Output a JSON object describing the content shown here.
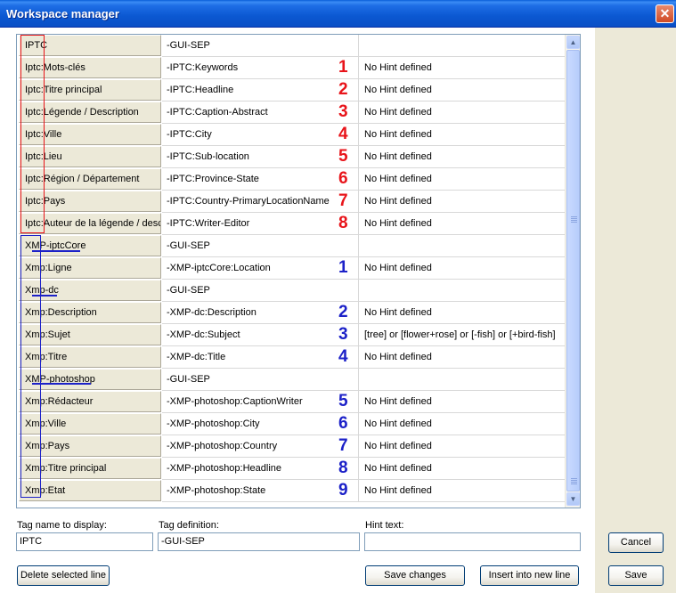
{
  "window": {
    "title": "Workspace manager",
    "close_glyph": "✕"
  },
  "grid": {
    "rows": [
      {
        "tag": "IPTC",
        "definition": "-GUI-SEP",
        "hint": "",
        "marker": ""
      },
      {
        "tag": "Iptc:Mots-clés",
        "definition": "-IPTC:Keywords",
        "hint": "No Hint defined",
        "marker": "1"
      },
      {
        "tag": "Iptc:Titre principal",
        "definition": "-IPTC:Headline",
        "hint": "No Hint defined",
        "marker": "2"
      },
      {
        "tag": "Iptc:Légende / Description",
        "definition": "-IPTC:Caption-Abstract",
        "hint": "No Hint defined",
        "marker": "3"
      },
      {
        "tag": "Iptc:Ville",
        "definition": "-IPTC:City",
        "hint": "No Hint defined",
        "marker": "4"
      },
      {
        "tag": "Iptc:Lieu",
        "definition": "-IPTC:Sub-location",
        "hint": "No Hint defined",
        "marker": "5"
      },
      {
        "tag": "Iptc:Région / Département",
        "definition": "-IPTC:Province-State",
        "hint": "No Hint defined",
        "marker": "6"
      },
      {
        "tag": "Iptc:Pays",
        "definition": "-IPTC:Country-PrimaryLocationName",
        "hint": "No Hint defined",
        "marker": "7"
      },
      {
        "tag": "Iptc:Auteur de la légende / descr",
        "definition": "-IPTC:Writer-Editor",
        "hint": "No Hint defined",
        "marker": "8"
      },
      {
        "tag": "XMP-iptcCore",
        "definition": "-GUI-SEP",
        "hint": "",
        "marker": ""
      },
      {
        "tag": "Xmp:Ligne",
        "definition": "-XMP-iptcCore:Location",
        "hint": "No Hint defined",
        "marker": "1"
      },
      {
        "tag": "Xmp-dc",
        "definition": "-GUI-SEP",
        "hint": "",
        "marker": ""
      },
      {
        "tag": "Xmp:Description",
        "definition": "-XMP-dc:Description",
        "hint": "No Hint defined",
        "marker": "2"
      },
      {
        "tag": "Xmp:Sujet",
        "definition": "-XMP-dc:Subject",
        "hint": "[tree] or [flower+rose] or [-fish] or [+bird-fish]",
        "marker": "3"
      },
      {
        "tag": "Xmp:Titre",
        "definition": "-XMP-dc:Title",
        "hint": "No Hint defined",
        "marker": "4"
      },
      {
        "tag": "XMP-photoshop",
        "definition": "-GUI-SEP",
        "hint": "",
        "marker": ""
      },
      {
        "tag": "Xmp:Rédacteur",
        "definition": "-XMP-photoshop:CaptionWriter",
        "hint": "No Hint defined",
        "marker": "5"
      },
      {
        "tag": "Xmp:Ville",
        "definition": "-XMP-photoshop:City",
        "hint": "No Hint defined",
        "marker": "6"
      },
      {
        "tag": "Xmp:Pays",
        "definition": "-XMP-photoshop:Country",
        "hint": "No Hint defined",
        "marker": "7"
      },
      {
        "tag": "Xmp:Titre principal",
        "definition": "-XMP-photoshop:Headline",
        "hint": "No Hint defined",
        "marker": "8"
      },
      {
        "tag": "Xmp:Etat",
        "definition": "-XMP-photoshop:State",
        "hint": "No Hint defined",
        "marker": "9"
      }
    ],
    "scroll_up_glyph": "▲",
    "scroll_down_glyph": "▼",
    "red_marker_color": "#e8141a",
    "blue_marker_color": "#1c21c8"
  },
  "editor": {
    "tag_name_label": "Tag name to display:",
    "tag_name_value": "IPTC",
    "tag_definition_label": "Tag definition:",
    "tag_definition_value": "-GUI-SEP",
    "hint_label": "Hint text:",
    "hint_value": ""
  },
  "buttons": {
    "delete_line": "Delete selected line",
    "save_changes": "Save changes",
    "insert_line": "Insert into new line",
    "cancel": "Cancel",
    "save": "Save"
  }
}
